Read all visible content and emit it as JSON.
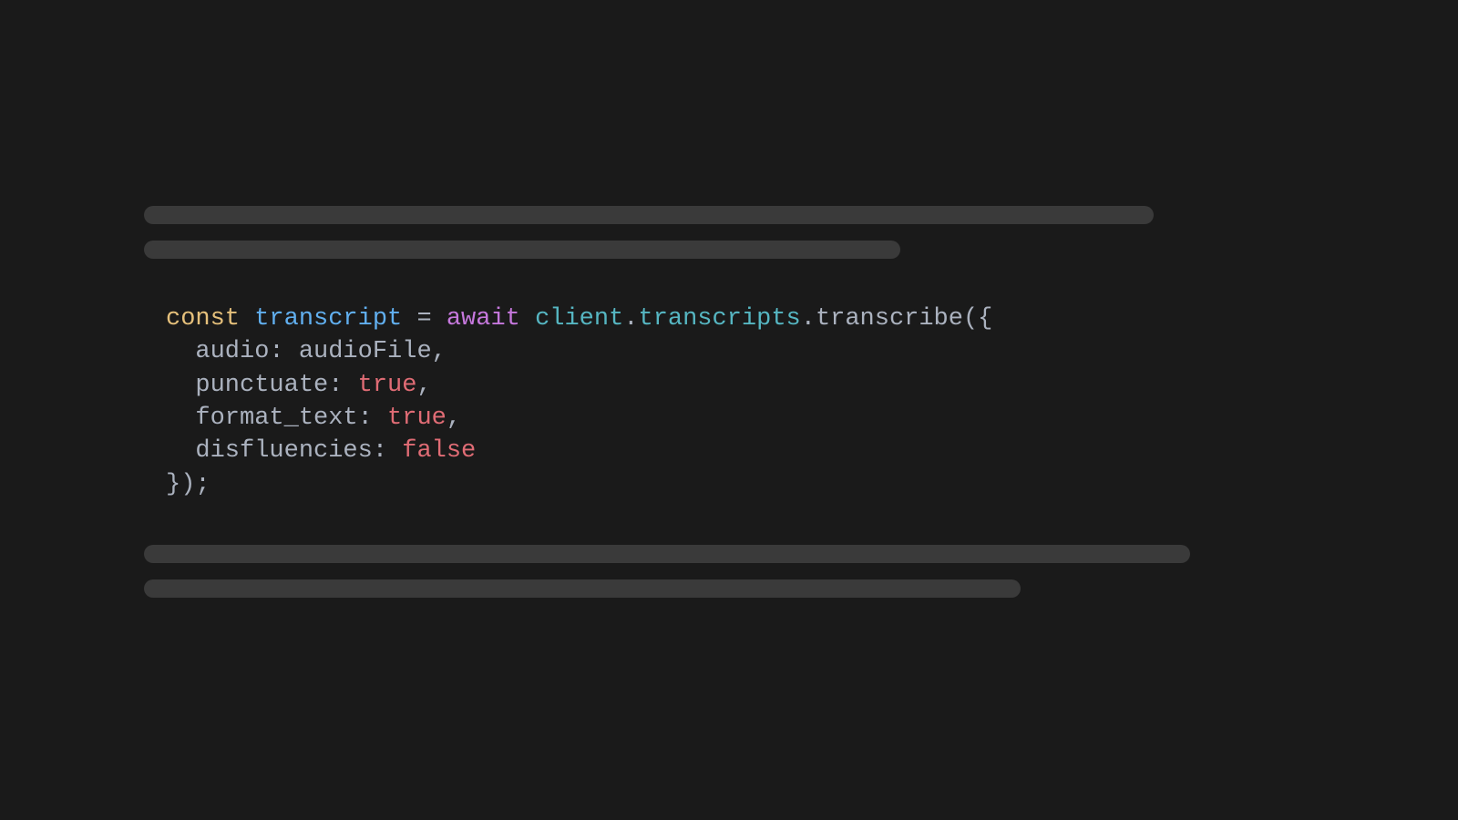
{
  "code": {
    "line1": {
      "keyword": "const",
      "space1": " ",
      "varname": "transcript",
      "space2": " ",
      "equals": "=",
      "space3": " ",
      "await": "await",
      "space4": " ",
      "obj1": "client",
      "dot1": ".",
      "obj2": "transcripts",
      "dot2": ".",
      "method": "transcribe",
      "open": "({"
    },
    "line2": {
      "indent": "  ",
      "prop": "audio",
      "colon": ":",
      "space": " ",
      "value": "audioFile",
      "comma": ","
    },
    "line3": {
      "indent": "  ",
      "prop": "punctuate",
      "colon": ":",
      "space": " ",
      "value": "true",
      "comma": ","
    },
    "line4": {
      "indent": "  ",
      "prop": "format_text",
      "colon": ":",
      "space": " ",
      "value": "true",
      "comma": ","
    },
    "line5": {
      "indent": "  ",
      "prop": "disfluencies",
      "colon": ":",
      "space": " ",
      "value": "false"
    },
    "line6": {
      "close": "});"
    }
  }
}
